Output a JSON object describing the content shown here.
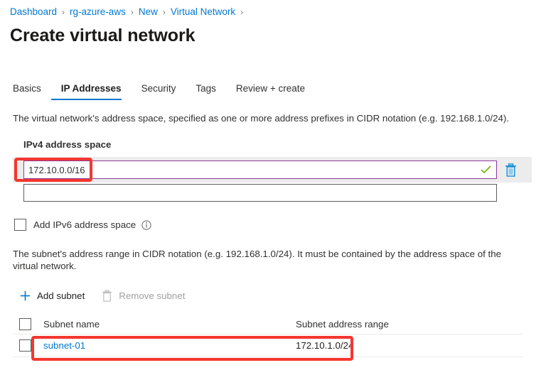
{
  "breadcrumb": {
    "items": [
      {
        "label": "Dashboard"
      },
      {
        "label": "rg-azure-aws"
      },
      {
        "label": "New"
      },
      {
        "label": "Virtual Network"
      }
    ],
    "separator": "›"
  },
  "page": {
    "title": "Create virtual network"
  },
  "tabs": [
    {
      "label": "Basics",
      "active": false
    },
    {
      "label": "IP Addresses",
      "active": true
    },
    {
      "label": "Security",
      "active": false
    },
    {
      "label": "Tags",
      "active": false
    },
    {
      "label": "Review + create",
      "active": false
    }
  ],
  "vnet_section": {
    "description": "The virtual network's address space, specified as one or more address prefixes in CIDR notation (e.g. 192.168.1.0/24).",
    "field_label": "IPv4 address space",
    "address_rows": [
      {
        "value": "172.10.0.0/16",
        "placeholder": "",
        "valid_icon": "checkmark-icon",
        "delete_icon": "trash-icon"
      },
      {
        "value": "",
        "placeholder": ""
      }
    ],
    "ipv6_checkbox": {
      "label": "Add IPv6 address space",
      "checked": false,
      "info_icon": "info-icon"
    }
  },
  "subnet_section": {
    "description": "The subnet's address range in CIDR notation (e.g. 192.168.1.0/24). It must be contained by the address space of the virtual network.",
    "commands": [
      {
        "label": "Add subnet",
        "icon": "plus-icon",
        "enabled": true
      },
      {
        "label": "Remove subnet",
        "icon": "trash-icon",
        "enabled": false
      }
    ],
    "table": {
      "columns": [
        "Subnet name",
        "Subnet address range"
      ],
      "rows": [
        {
          "name": "subnet-01",
          "range": "172.10.1.0/24",
          "selected": false
        }
      ]
    }
  },
  "colors": {
    "accent_blue": "#0078d4",
    "link_blue": "#0078d4",
    "annotation_red": "#f4372f",
    "focus_purple": "#8e3a96",
    "valid_green": "#6bb700",
    "shaded_row": "#ececec",
    "disabled_gray": "#a19f9d"
  }
}
